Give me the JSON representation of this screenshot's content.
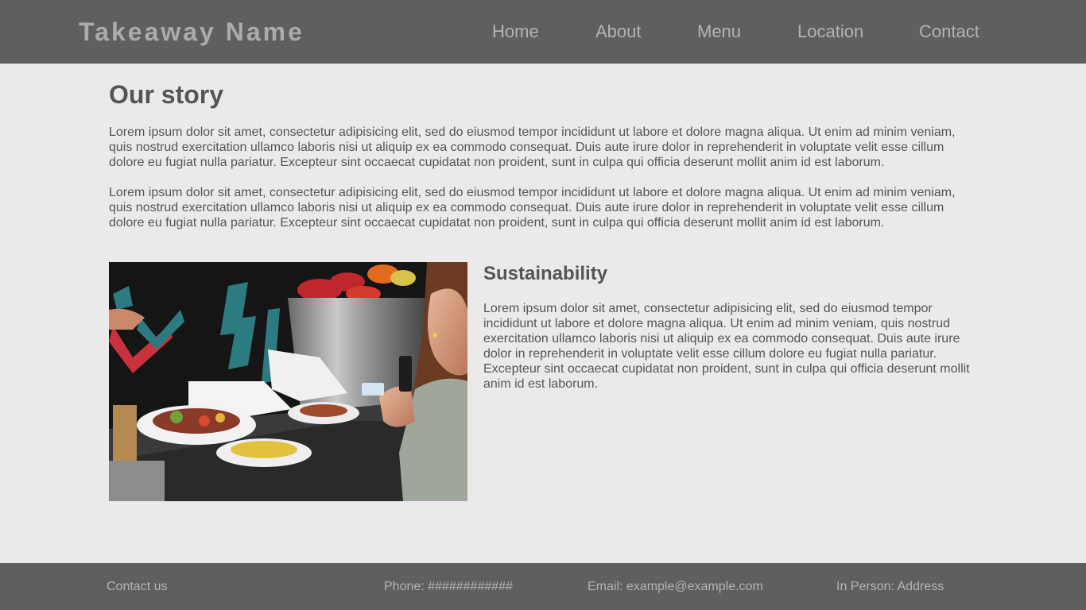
{
  "header": {
    "brand": "Takeaway Name",
    "nav": [
      "Home",
      "About",
      "Menu",
      "Location",
      "Contact"
    ]
  },
  "story": {
    "title": "Our story",
    "paragraphs": [
      "Lorem ipsum dolor sit amet, consectetur adipisicing elit, sed do eiusmod tempor incididunt ut labore et dolore magna aliqua. Ut enim ad minim veniam, quis nostrud exercitation ullamco laboris nisi ut aliquip ex ea commodo consequat. Duis aute irure dolor in reprehenderit in voluptate velit esse cillum dolore eu fugiat nulla pariatur. Excepteur sint occaecat cupidatat non proident, sunt in culpa qui officia deserunt mollit anim id est laborum.",
      "Lorem ipsum dolor sit amet, consectetur adipisicing elit, sed do eiusmod tempor incididunt ut labore et dolore magna aliqua. Ut enim ad minim veniam, quis nostrud exercitation ullamco laboris nisi ut aliquip ex ea commodo consequat. Duis aute irure dolor in reprehenderit in voluptate velit esse cillum dolore eu fugiat nulla pariatur. Excepteur sint occaecat cupidatat non proident, sunt in culpa qui officia deserunt mollit anim id est laborum."
    ]
  },
  "sustainability": {
    "title": "Sustainability",
    "paragraph": "Lorem ipsum dolor sit amet, consectetur adipisicing elit, sed do eiusmod tempor incididunt ut labore et dolore magna aliqua. Ut enim ad minim veniam, quis nostrud exercitation ullamco laboris nisi ut aliquip ex ea commodo consequat. Duis aute irure dolor in reprehenderit in voluptate velit esse cillum dolore eu fugiat nulla pariatur. Excepteur sint occaecat cupidatat non proident, sunt in culpa qui officia deserunt mollit anim id est laborum."
  },
  "footer": {
    "contact_us": "Contact us",
    "phone": "Phone: ############",
    "email": "Email: example@example.com",
    "in_person": "In Person: Address"
  },
  "colors": {
    "header_bg": "#5f5f5f",
    "page_bg": "#eaeaea",
    "text": "#555555",
    "muted_text": "#b3b3b3"
  }
}
